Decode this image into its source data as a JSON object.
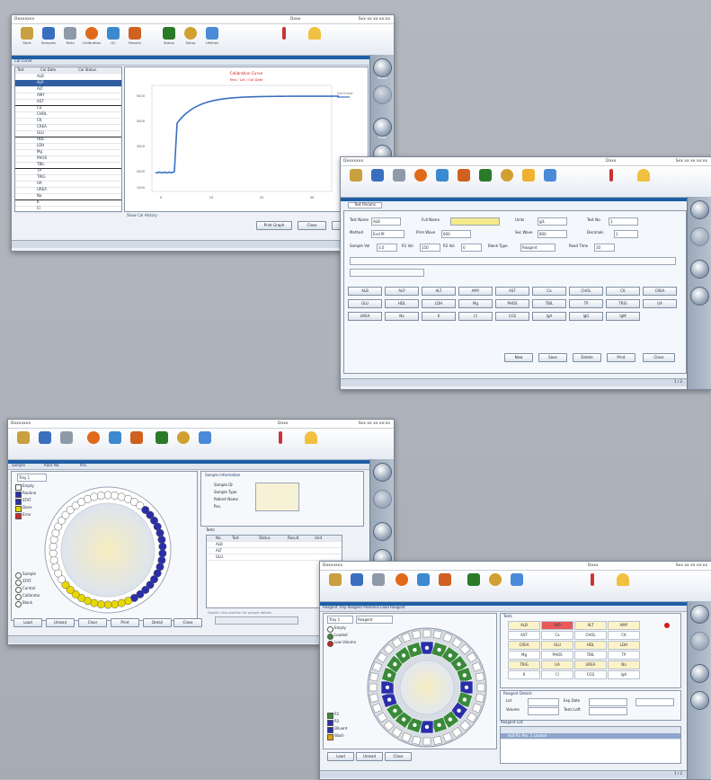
{
  "common": {
    "toolbar_icons": [
      {
        "icon": "start-icon",
        "label": "Start",
        "color": "#c8a040"
      },
      {
        "icon": "samples-icon",
        "label": "Samples",
        "color": "#3a6fc0"
      },
      {
        "icon": "tests-icon",
        "label": "Tests",
        "color": "#8f9aa8"
      },
      {
        "icon": "calibration-icon",
        "label": "Calibration",
        "color": "#e06a1a"
      },
      {
        "icon": "qc-icon",
        "label": "QC",
        "color": "#3b8ad0"
      },
      {
        "icon": "results-icon",
        "label": "Results",
        "color": "#d06020"
      },
      {
        "icon": "status-icon",
        "label": "Status",
        "color": "#2a7a2a"
      },
      {
        "icon": "setup-icon",
        "label": "Setup",
        "color": "#d2a030"
      },
      {
        "icon": "reagents-icon",
        "label": "Reagents",
        "color": "#f0b030"
      },
      {
        "icon": "utilities-icon",
        "label": "Utilities",
        "color": "#4a8ad8"
      }
    ],
    "alert_icons": [
      {
        "icon": "lamp-alert-icon",
        "color": "#cc3333"
      },
      {
        "icon": "bell-alert-icon",
        "color": "#f0c040"
      }
    ],
    "side_buttons": [
      "Home",
      "Print",
      "Help",
      "Stop"
    ]
  },
  "w1": {
    "title": "Dxxxxxxx",
    "user": "Dxxx",
    "datetime": "Sxx xx xx  xx:xx",
    "crumb": "Cal Curve",
    "list_headers": [
      "Test",
      "Cal Date",
      "Cal Status"
    ],
    "list_rows": [
      "ALB",
      "ALP",
      "ALT",
      "AMY",
      "AST",
      "Ca",
      "CHOL",
      "CK",
      "CREA",
      "GLU",
      "HDL",
      "LDH",
      "Mg",
      "PHOS",
      "TBIL",
      "TP",
      "TRIG",
      "UA",
      "UREA",
      "Na",
      "K",
      "Cl"
    ],
    "chart_title": "Calibration Curve",
    "chart_subtitle": "Test / Lot / Cal Date",
    "y_ticks": [
      "5000",
      "4000",
      "3000",
      "2000",
      "1000"
    ],
    "x_ticks": [
      "0",
      "10",
      "20",
      "30"
    ],
    "legend": "Cal Curve",
    "footer_note": "Show Cal History",
    "buttons": [
      "Print Graph",
      "Close",
      "Exit"
    ]
  },
  "w2": {
    "title": "Dxxxxxxx",
    "user": "Dxxx",
    "datetime": "Sxx xx xx  xx:xx",
    "tab": "Test Params",
    "fields": [
      {
        "label": "Test Name",
        "value": "ALB"
      },
      {
        "label": "Full Name",
        "value": ""
      },
      {
        "label": "Units",
        "value": "g/L"
      },
      {
        "label": "Test No.",
        "value": "1"
      },
      {
        "label": "Method",
        "value": "End Pt"
      },
      {
        "label": "Prim Wave",
        "value": "600"
      },
      {
        "label": "Sec Wave",
        "value": "800"
      },
      {
        "label": "Decimals",
        "value": "1"
      },
      {
        "label": "Sample Vol",
        "value": "3.0"
      },
      {
        "label": "R1 Vol",
        "value": "150"
      },
      {
        "label": "R2 Vol",
        "value": "0"
      },
      {
        "label": "Blank Type",
        "value": "Reagent"
      },
      {
        "label": "Read Time",
        "value": "10"
      }
    ],
    "grid_buttons": [
      "ALB",
      "ALP",
      "ALT",
      "AMY",
      "AST",
      "Ca",
      "CHOL",
      "CK",
      "CREA",
      "GLU",
      "HDL",
      "LDH",
      "Mg",
      "PHOS",
      "TBIL",
      "TP",
      "TRIG",
      "UA",
      "UREA",
      "Na",
      "K",
      "Cl",
      "CO2",
      "IgA",
      "IgG",
      "IgM"
    ],
    "buttons": [
      "New",
      "Save",
      "Delete",
      "Print",
      "Close"
    ],
    "page": "1 / 2"
  },
  "w3": {
    "title": "Dxxxxxxx",
    "user": "Dxxx",
    "datetime": "Sxx xx xx  xx:xx",
    "tabs": [
      "Sample",
      "Rack No.",
      "Pos."
    ],
    "tray_label": "Tray 1",
    "legend": [
      {
        "label": "Empty",
        "color": "#ffffff"
      },
      {
        "label": "Routine",
        "color": "#2a2fa8"
      },
      {
        "label": "STAT",
        "color": "#2a2fa8"
      },
      {
        "label": "Done",
        "color": "#e8d800"
      },
      {
        "label": "Error",
        "color": "#cc2a2a"
      }
    ],
    "info_title": "Sample Information",
    "info_rows": [
      "Sample ID",
      "Sample Type",
      "Patient Name",
      "Pos."
    ],
    "table_title": "Tests",
    "table_headers": [
      "No.",
      "Test",
      "Status",
      "Result",
      "Unit"
    ],
    "table_rows": [
      "ALB",
      "ALT",
      "GLU"
    ],
    "radio_labels": [
      "Sample",
      "STAT",
      "Control",
      "Calibrator",
      "Blank"
    ],
    "bottom_note": "Double click position for sample details",
    "buttons": [
      "Load",
      "Unload",
      "Clear",
      "Print",
      "Detail",
      "Close"
    ],
    "tray_fill": {
      "blue": 16,
      "yellow": 11,
      "empty": 23
    }
  },
  "w4": {
    "title": "Dxxxxxxx",
    "user": "Dxxx",
    "datetime": "Sxx xx xx  xx:xx",
    "crumb": "Reagent Tray  Reagent Positions  Load Reagent",
    "tray_label": "Tray 1",
    "tray_field": "Reagent",
    "legend": [
      {
        "label": "Empty",
        "color": "#ffffff"
      },
      {
        "label": "Loaded",
        "color": "#3a8a3a"
      },
      {
        "label": "Low Volume",
        "color": "#cc2222"
      }
    ],
    "bottom_legend": [
      {
        "label": "R1",
        "color": "#3a8a3a"
      },
      {
        "label": "R2",
        "color": "#2a2fa8"
      },
      {
        "label": "Diluent",
        "color": "#2a2fa8"
      },
      {
        "label": "Wash",
        "color": "#e0a000"
      }
    ],
    "grid_title": "Tests",
    "grid_cells": [
      "ALB",
      "ALP",
      "ALT",
      "AMY",
      "AST",
      "Ca",
      "CHOL",
      "CK",
      "CREA",
      "GLU",
      "HDL",
      "LDH",
      "Mg",
      "PHOS",
      "TBIL",
      "TP",
      "TRIG",
      "UA",
      "UREA",
      "Na",
      "K",
      "Cl",
      "CO2",
      "IgA"
    ],
    "details_title": "Reagent Details",
    "details_rows": [
      "Lot",
      "Exp Date",
      "Volume",
      "Tests Left"
    ],
    "list_title": "Reagent List",
    "list_row": "ALB  R1  Pos. 1  Loaded",
    "buttons": [
      "Load",
      "Unload",
      "Close"
    ],
    "page": "1 / 2"
  }
}
